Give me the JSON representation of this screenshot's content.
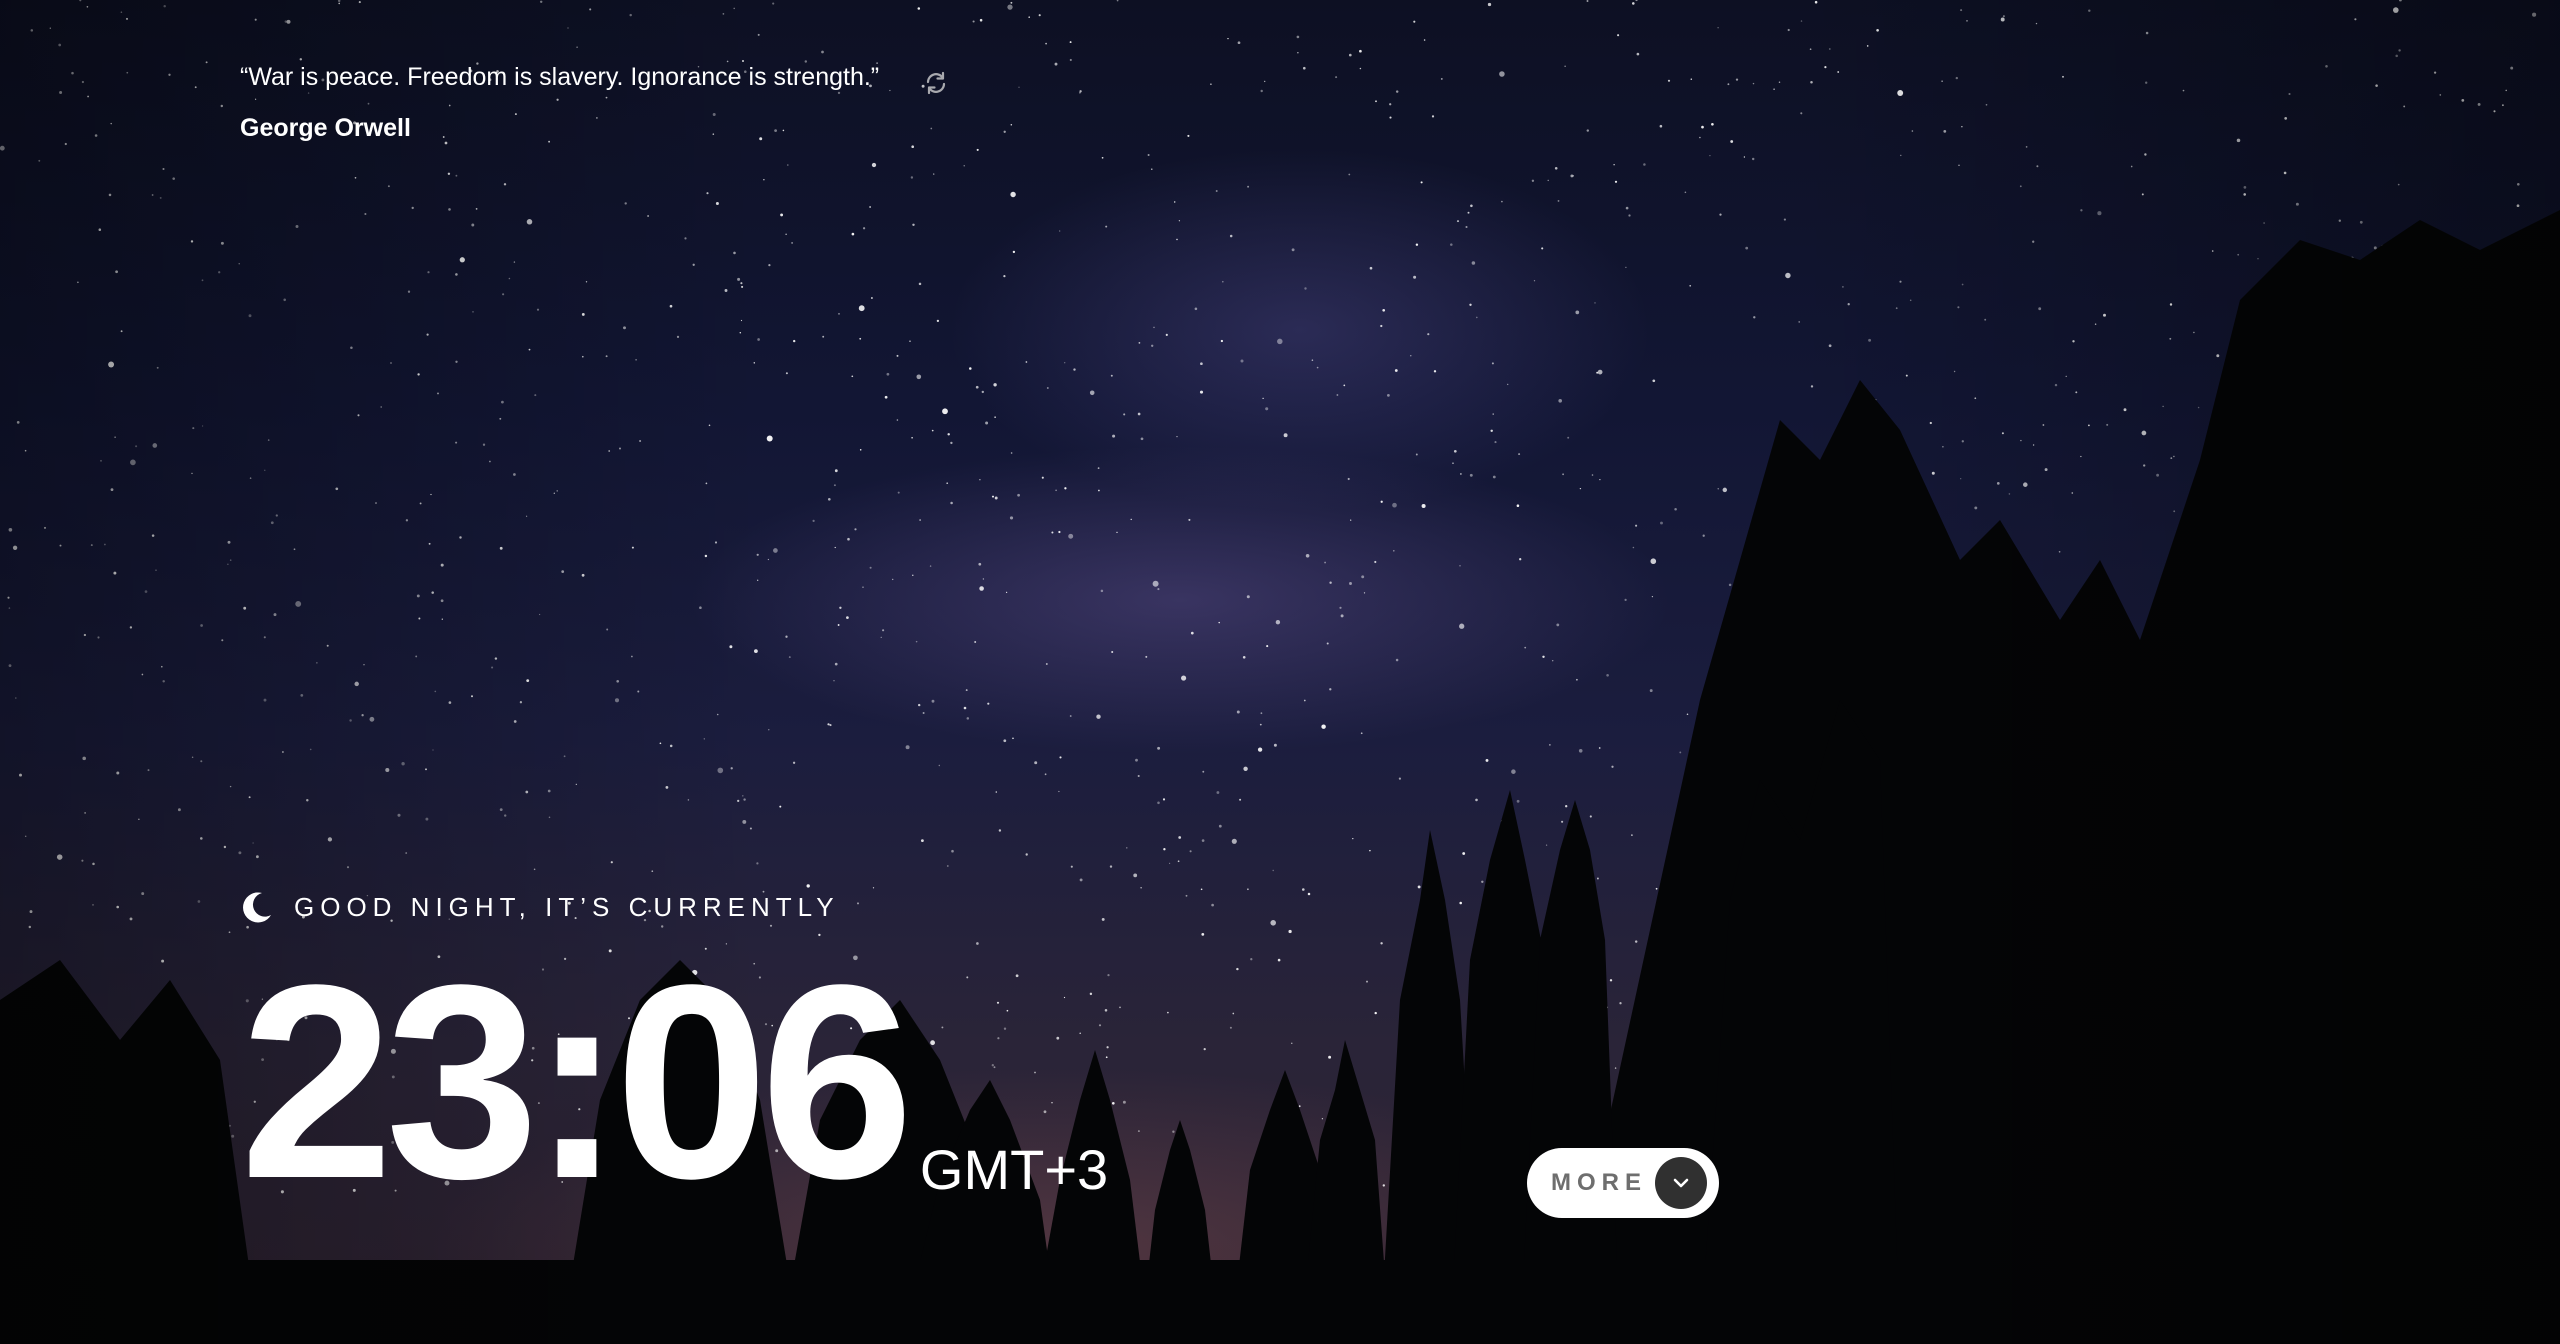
{
  "quote": {
    "text": "“War is peace. Freedom is slavery. Ignorance is strength.”",
    "author": "George Orwell",
    "refresh_icon": "refresh-icon"
  },
  "greeting": {
    "icon": "moon-icon",
    "text": "GOOD NIGHT, IT’S CURRENTLY"
  },
  "clock": {
    "time": "23:06",
    "timezone": "GMT+3"
  },
  "more_button": {
    "label": "MORE",
    "icon": "chevron-down-icon"
  },
  "colors": {
    "text": "#ffffff",
    "button_bg": "#ffffff",
    "button_text": "#6e6e6e",
    "chevron_bg": "#303030"
  }
}
